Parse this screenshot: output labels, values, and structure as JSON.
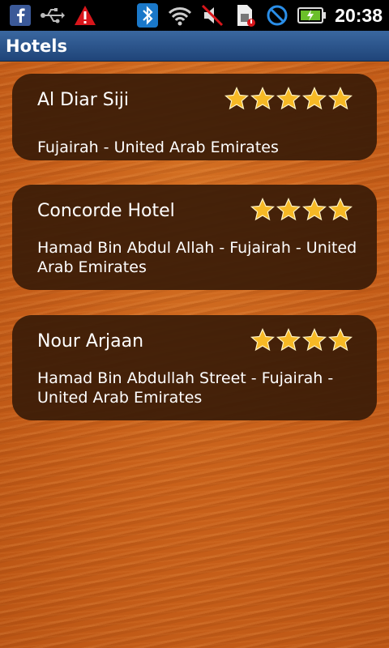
{
  "status_bar": {
    "time": "20:38",
    "left_icons": [
      "facebook-icon",
      "usb-icon",
      "warning-icon"
    ],
    "right_icons": [
      "bluetooth-icon",
      "wifi-icon",
      "vibrate-off-icon",
      "sim-icon",
      "no-signal-icon",
      "battery-icon"
    ]
  },
  "header": {
    "title": "Hotels"
  },
  "hotels": [
    {
      "name": "Al Diar Siji",
      "stars": 5,
      "address": "Fujairah - United Arab Emirates"
    },
    {
      "name": "Concorde Hotel",
      "stars": 4,
      "address": "Hamad Bin Abdul Allah - Fujairah - United Arab Emirates"
    },
    {
      "name": "Nour Arjaan",
      "stars": 4,
      "address": "Hamad Bin Abdullah Street - Fujairah - United Arab Emirates"
    }
  ],
  "colors": {
    "title_bar": "#2b5690",
    "card_bg": "#3a1c08",
    "star_fill": "#f6b925",
    "background": "#c9651b"
  }
}
